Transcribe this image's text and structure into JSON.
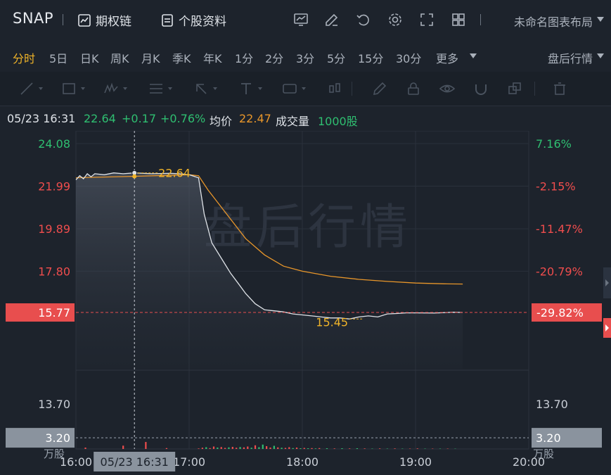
{
  "header": {
    "ticker": "SNAP",
    "options_chain_label": "期权链",
    "profile_label": "个股资料",
    "layout_name": "未命名图表布局"
  },
  "periods": {
    "items": [
      "分时",
      "5日",
      "日K",
      "周K",
      "月K",
      "季K",
      "年K",
      "1分",
      "2分",
      "3分",
      "5分",
      "15分",
      "30分",
      "更多"
    ],
    "active": "分时",
    "session_label": "盘后行情"
  },
  "info": {
    "datetime": "05/23 16:31",
    "price": "22.64",
    "change": "+0.17",
    "change_pct": "+0.76%",
    "avg_label": "均价",
    "avg_value": "22.47",
    "volume_label": "成交量",
    "volume_value": "1000股"
  },
  "watermark": "盘后行情",
  "chart_data": {
    "type": "line",
    "left_axis_labels": [
      "24.08",
      "21.99",
      "19.89",
      "17.80"
    ],
    "right_axis_labels": [
      "7.16%",
      "-2.15%",
      "-11.47%",
      "-20.79%"
    ],
    "current_price_tag": "15.77",
    "current_pct_tag": "-29.82%",
    "high_annotation": "22.64",
    "low_annotation": "15.45",
    "volume_axis_top_label": "13.70",
    "volume_axis_cursor_label": "3.20",
    "volume_unit_label": "万股",
    "x_ticks": [
      "16:00",
      "17:00",
      "18:00",
      "19:00",
      "20:00"
    ],
    "cursor_time_label": "05/23 16:31",
    "y_range": [
      13.0,
      24.5
    ],
    "colors": {
      "up": "#ef4d4d",
      "down": "#2fbf71",
      "avg": "#e8962a",
      "price": "#dfe3e8",
      "accent": "#f0b429"
    },
    "price_series": [
      [
        "16:00",
        22.3
      ],
      [
        "16:02",
        22.5
      ],
      [
        "16:04",
        22.35
      ],
      [
        "16:06",
        22.6
      ],
      [
        "16:08",
        22.45
      ],
      [
        "16:10",
        22.6
      ],
      [
        "16:15",
        22.55
      ],
      [
        "16:20",
        22.64
      ],
      [
        "16:25",
        22.6
      ],
      [
        "16:31",
        22.64
      ],
      [
        "16:40",
        22.6
      ],
      [
        "16:50",
        22.62
      ],
      [
        "16:55",
        22.6
      ],
      [
        "17:00",
        22.55
      ],
      [
        "17:05",
        22.4
      ],
      [
        "17:08",
        20.6
      ],
      [
        "17:12",
        19.2
      ],
      [
        "17:18",
        18.3
      ],
      [
        "17:22",
        17.7
      ],
      [
        "17:26",
        17.2
      ],
      [
        "17:30",
        16.7
      ],
      [
        "17:35",
        16.2
      ],
      [
        "17:40",
        15.9
      ],
      [
        "17:45",
        15.85
      ],
      [
        "17:50",
        15.8
      ],
      [
        "17:55",
        15.7
      ],
      [
        "18:00",
        15.65
      ],
      [
        "18:05",
        15.6
      ],
      [
        "18:10",
        15.55
      ],
      [
        "18:15",
        15.5
      ],
      [
        "18:20",
        15.5
      ],
      [
        "18:25",
        15.45
      ],
      [
        "18:30",
        15.55
      ],
      [
        "18:35",
        15.6
      ],
      [
        "18:40",
        15.55
      ],
      [
        "18:45",
        15.7
      ],
      [
        "18:50",
        15.72
      ],
      [
        "18:55",
        15.75
      ],
      [
        "19:00",
        15.75
      ],
      [
        "19:10",
        15.74
      ],
      [
        "19:20",
        15.78
      ],
      [
        "19:25",
        15.77
      ]
    ],
    "avg_series": [
      [
        "16:00",
        22.4
      ],
      [
        "16:30",
        22.47
      ],
      [
        "17:00",
        22.55
      ],
      [
        "17:05",
        22.5
      ],
      [
        "17:10",
        21.8
      ],
      [
        "17:20",
        20.6
      ],
      [
        "17:30",
        19.4
      ],
      [
        "17:40",
        18.6
      ],
      [
        "17:50",
        18.05
      ],
      [
        "18:00",
        17.8
      ],
      [
        "18:15",
        17.55
      ],
      [
        "18:30",
        17.4
      ],
      [
        "18:45",
        17.3
      ],
      [
        "19:00",
        17.22
      ],
      [
        "19:15",
        17.18
      ],
      [
        "19:25",
        17.17
      ]
    ],
    "volume_bars": [
      [
        "16:05",
        0.4,
        "up"
      ],
      [
        "16:25",
        0.95,
        "up"
      ],
      [
        "16:37",
        2.0,
        "up"
      ],
      [
        "16:48",
        0.25,
        "up"
      ],
      [
        "17:05",
        0.15,
        "up"
      ],
      [
        "17:07",
        0.35,
        "up"
      ],
      [
        "17:09",
        0.5,
        "down"
      ],
      [
        "17:11",
        0.25,
        "up"
      ],
      [
        "17:13",
        0.7,
        "up"
      ],
      [
        "17:15",
        0.4,
        "down"
      ],
      [
        "17:17",
        0.55,
        "up"
      ],
      [
        "17:19",
        0.3,
        "up"
      ],
      [
        "17:21",
        0.45,
        "down"
      ],
      [
        "17:23",
        0.6,
        "up"
      ],
      [
        "17:25",
        0.35,
        "up"
      ],
      [
        "17:27",
        0.55,
        "down"
      ],
      [
        "17:29",
        0.45,
        "up"
      ],
      [
        "17:31",
        0.7,
        "up"
      ],
      [
        "17:33",
        0.35,
        "down"
      ],
      [
        "17:35",
        1.05,
        "up"
      ],
      [
        "17:37",
        0.5,
        "down"
      ],
      [
        "17:39",
        1.25,
        "down"
      ],
      [
        "17:41",
        0.8,
        "up"
      ],
      [
        "17:43",
        0.4,
        "up"
      ],
      [
        "17:45",
        0.9,
        "down"
      ],
      [
        "17:47",
        0.45,
        "up"
      ],
      [
        "17:49",
        0.35,
        "down"
      ],
      [
        "17:51",
        0.3,
        "up"
      ],
      [
        "17:53",
        0.5,
        "up"
      ],
      [
        "17:55",
        0.25,
        "down"
      ],
      [
        "17:57",
        0.4,
        "up"
      ],
      [
        "17:59",
        0.2,
        "down"
      ],
      [
        "18:01",
        0.3,
        "up"
      ],
      [
        "18:03",
        0.2,
        "down"
      ],
      [
        "18:05",
        0.25,
        "up"
      ],
      [
        "18:07",
        0.15,
        "down"
      ],
      [
        "18:09",
        0.25,
        "up"
      ],
      [
        "18:13",
        0.2,
        "down"
      ],
      [
        "18:17",
        0.15,
        "up"
      ],
      [
        "18:21",
        0.2,
        "down"
      ],
      [
        "18:25",
        0.15,
        "up"
      ],
      [
        "18:29",
        0.2,
        "down"
      ],
      [
        "18:33",
        0.15,
        "up"
      ],
      [
        "18:37",
        0.1,
        "down"
      ],
      [
        "18:41",
        0.15,
        "up"
      ],
      [
        "18:45",
        0.1,
        "down"
      ],
      [
        "18:49",
        0.15,
        "up"
      ],
      [
        "18:53",
        0.1,
        "down"
      ],
      [
        "18:57",
        0.1,
        "up"
      ],
      [
        "19:01",
        0.15,
        "up"
      ],
      [
        "19:05",
        0.1,
        "down"
      ],
      [
        "19:09",
        0.1,
        "up"
      ],
      [
        "19:13",
        0.1,
        "down"
      ],
      [
        "19:17",
        0.1,
        "up"
      ],
      [
        "19:21",
        0.08,
        "down"
      ]
    ]
  }
}
